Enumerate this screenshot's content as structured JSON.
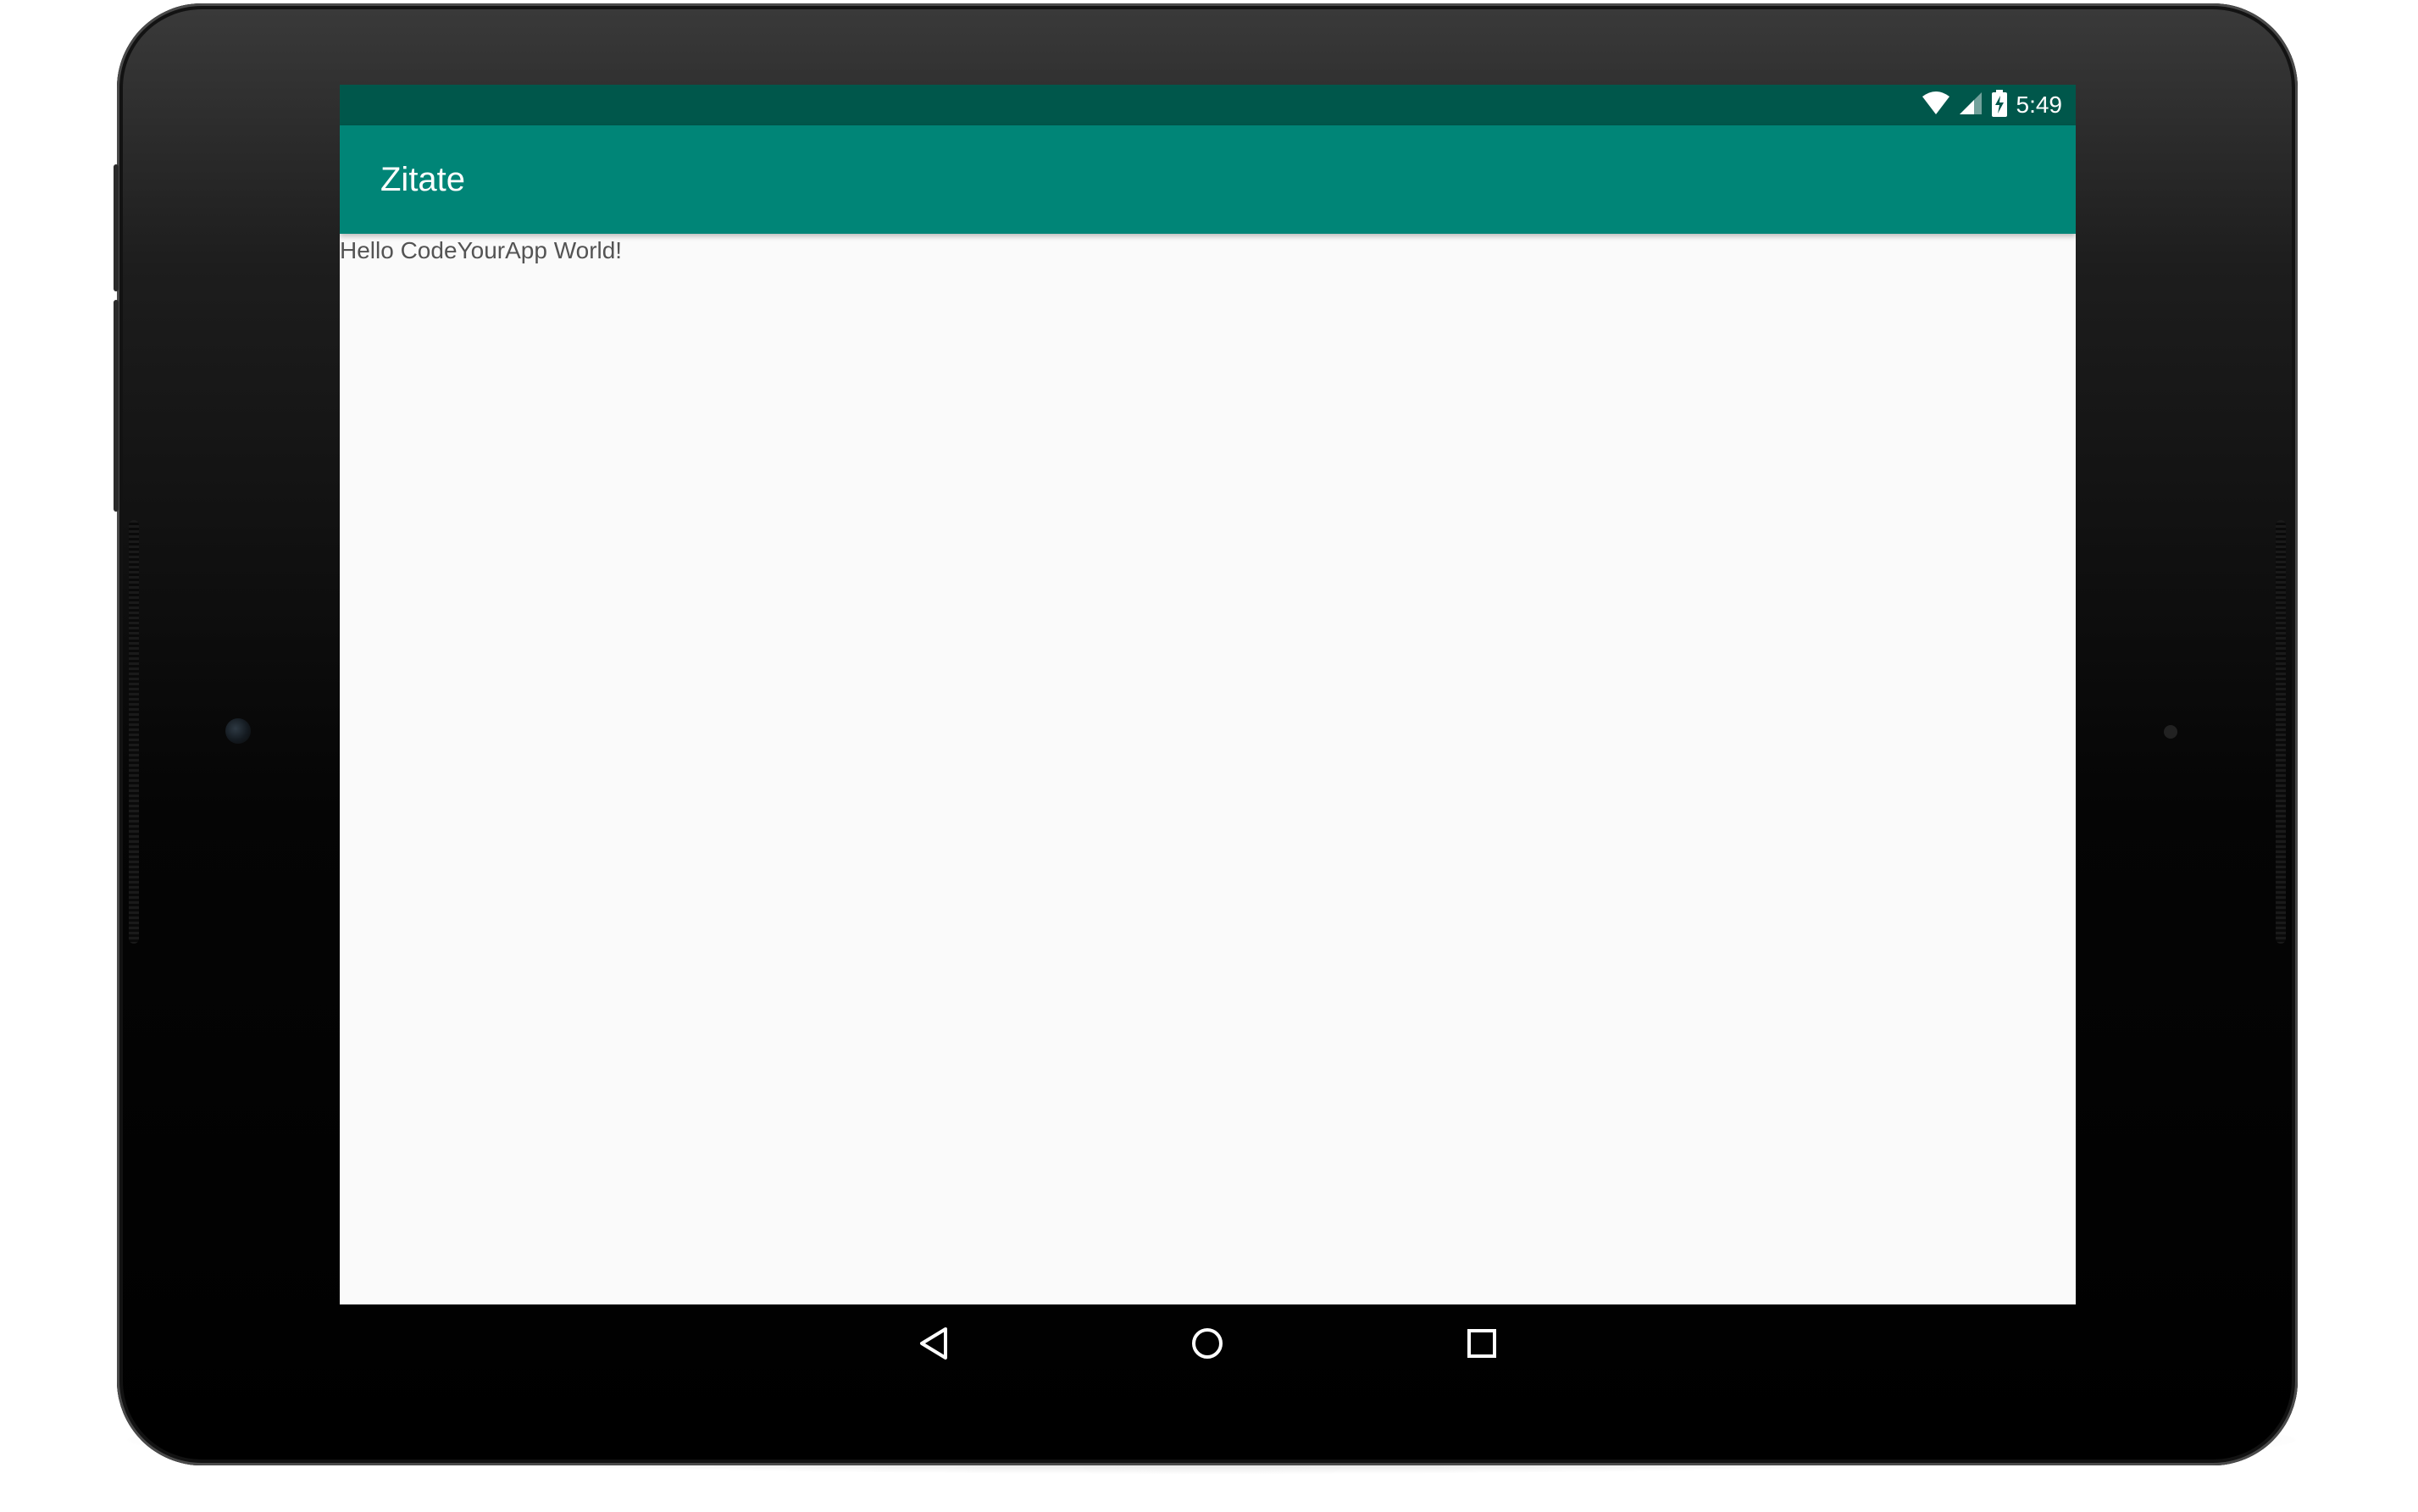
{
  "status_bar": {
    "time": "5:49",
    "icons": [
      "wifi-icon",
      "cell-signal-icon",
      "battery-charging-icon"
    ],
    "color": "#00574b"
  },
  "app_bar": {
    "title": "Zitate",
    "color": "#008577"
  },
  "content": {
    "text": "Hello CodeYourApp World!"
  },
  "nav_bar": {
    "buttons": [
      "back-icon",
      "home-icon",
      "recents-icon"
    ]
  },
  "colors": {
    "background": "#fafafa",
    "text": "#545454"
  }
}
